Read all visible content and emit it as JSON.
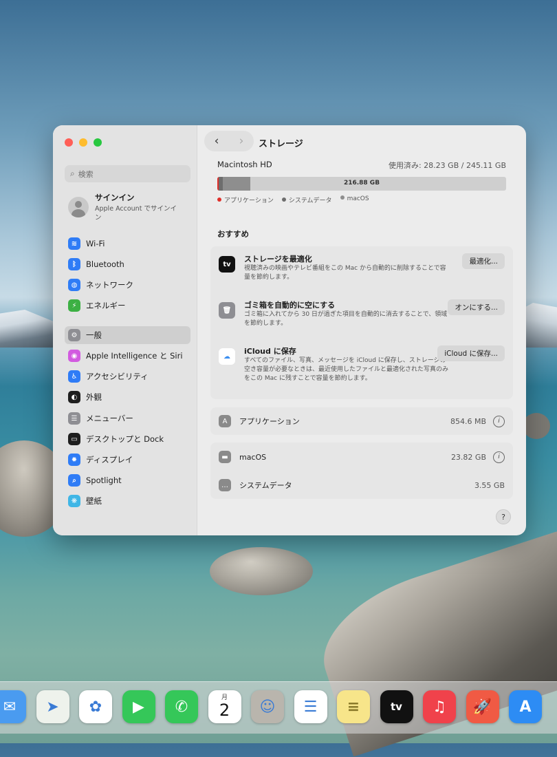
{
  "window": {
    "title": "ストレージ"
  },
  "sidebar": {
    "search_placeholder": "検索",
    "account": {
      "name": "サインイン",
      "sub": "Apple Account でサインイン"
    },
    "items": [
      {
        "label": "Wi-Fi",
        "icon": "wifi-icon",
        "color": "#2f7cf6",
        "glyph": "≋"
      },
      {
        "label": "Bluetooth",
        "icon": "bluetooth-icon",
        "color": "#2f7cf6",
        "glyph": "ᛒ"
      },
      {
        "label": "ネットワーク",
        "icon": "network-icon",
        "color": "#2f7cf6",
        "glyph": "◍"
      },
      {
        "label": "エネルギー",
        "icon": "energy-icon",
        "color": "#3cb043",
        "glyph": "⚡"
      },
      {
        "label": "一般",
        "icon": "general-icon",
        "color": "#8e8e93",
        "glyph": "⚙",
        "selected": true
      },
      {
        "label": "Apple Intelligence と Siri",
        "icon": "siri-icon",
        "color": "#d25be0",
        "glyph": "◉"
      },
      {
        "label": "アクセシビリティ",
        "icon": "accessibility-icon",
        "color": "#2f7cf6",
        "glyph": "♿"
      },
      {
        "label": "外観",
        "icon": "appearance-icon",
        "color": "#1e1e1e",
        "glyph": "◐"
      },
      {
        "label": "メニューバー",
        "icon": "menubar-icon",
        "color": "#8e8e93",
        "glyph": "☰"
      },
      {
        "label": "デスクトップと Dock",
        "icon": "desktop-dock-icon",
        "color": "#1e1e1e",
        "glyph": "▭"
      },
      {
        "label": "ディスプレイ",
        "icon": "display-icon",
        "color": "#2f7cf6",
        "glyph": "✹"
      },
      {
        "label": "Spotlight",
        "icon": "spotlight-icon",
        "color": "#2f7cf6",
        "glyph": "⌕"
      },
      {
        "label": "壁紙",
        "icon": "wallpaper-icon",
        "color": "#3fb6e6",
        "glyph": "❋"
      }
    ]
  },
  "storage": {
    "disk_name": "Macintosh HD",
    "used_text": "使用済み: 28.23 GB / 245.11 GB",
    "bar_label": "216.88 GB",
    "used_fraction": 0.115,
    "segments": [
      {
        "name": "apps",
        "fraction": 0.005,
        "color": "#e0302a"
      },
      {
        "name": "system",
        "fraction": 0.015,
        "color": "#6d6d6d"
      },
      {
        "name": "macos",
        "fraction": 0.095,
        "color": "#8e8e8e"
      }
    ],
    "legend": [
      {
        "label": "アプリケーション",
        "color": "#e0302a"
      },
      {
        "label": "システムデータ",
        "color": "#6d6d6d"
      },
      {
        "label": "macOS",
        "color": "#8e8e8e"
      }
    ]
  },
  "recommendations": {
    "title": "おすすめ",
    "items": [
      {
        "title": "ストレージを最適化",
        "desc": "視聴済みの映画やテレビ番組をこの Mac から自動的に削除することで容量を節約します。",
        "button": "最適化...",
        "icon": "appletv-icon",
        "icon_text": "tv"
      },
      {
        "title": "ゴミ箱を自動的に空にする",
        "desc": "ゴミ箱に入れてから 30 日が過ぎた項目を自動的に消去することで、領域を節約します。",
        "button": "オンにする...",
        "icon": "trash-icon",
        "icon_text": "🗑"
      },
      {
        "title": "iCloud に保存",
        "desc": "すべてのファイル、写真、メッセージを iCloud に保存し、ストレージの空き容量が必要なときは、最近使用したファイルと最適化された写真のみをこの Mac に残すことで容量を節約します。",
        "button": "iCloud に保存...",
        "icon": "icloud-icon",
        "icon_text": "☁"
      }
    ]
  },
  "categories": [
    {
      "label": "アプリケーション",
      "size": "854.6 MB",
      "icon": "applications-icon",
      "glyph": "A",
      "info": true
    },
    {
      "label": "macOS",
      "size": "23.82 GB",
      "icon": "macos-icon",
      "glyph": "▬",
      "info": true
    },
    {
      "label": "システムデータ",
      "size": "3.55 GB",
      "icon": "system-data-icon",
      "glyph": "…",
      "info": false
    }
  ],
  "help_label": "?",
  "dock": {
    "calendar_month": "月",
    "calendar_day": "2",
    "apps": [
      {
        "name": "mail",
        "color": "#4a9bf0",
        "glyph": "✉"
      },
      {
        "name": "maps",
        "color": "#eef2ec",
        "glyph": "➤"
      },
      {
        "name": "photos",
        "color": "#ffffff",
        "glyph": "✿"
      },
      {
        "name": "facetime",
        "color": "#35c759",
        "glyph": "▶"
      },
      {
        "name": "phone",
        "color": "#35c759",
        "glyph": "✆"
      },
      {
        "name": "calendar",
        "color": "#ffffff",
        "glyph": ""
      },
      {
        "name": "contacts",
        "color": "#b9b5ad",
        "glyph": "☺"
      },
      {
        "name": "reminders",
        "color": "#ffffff",
        "glyph": "☰"
      },
      {
        "name": "notes",
        "color": "#f7e58a",
        "glyph": "≡"
      },
      {
        "name": "tv",
        "color": "#111111",
        "glyph": "tv"
      },
      {
        "name": "music",
        "color": "#f0424b",
        "glyph": "♫"
      },
      {
        "name": "launchpad",
        "color": "#f05a44",
        "glyph": "🚀"
      },
      {
        "name": "app-store",
        "color": "#2d8cf4",
        "glyph": "A"
      }
    ]
  }
}
